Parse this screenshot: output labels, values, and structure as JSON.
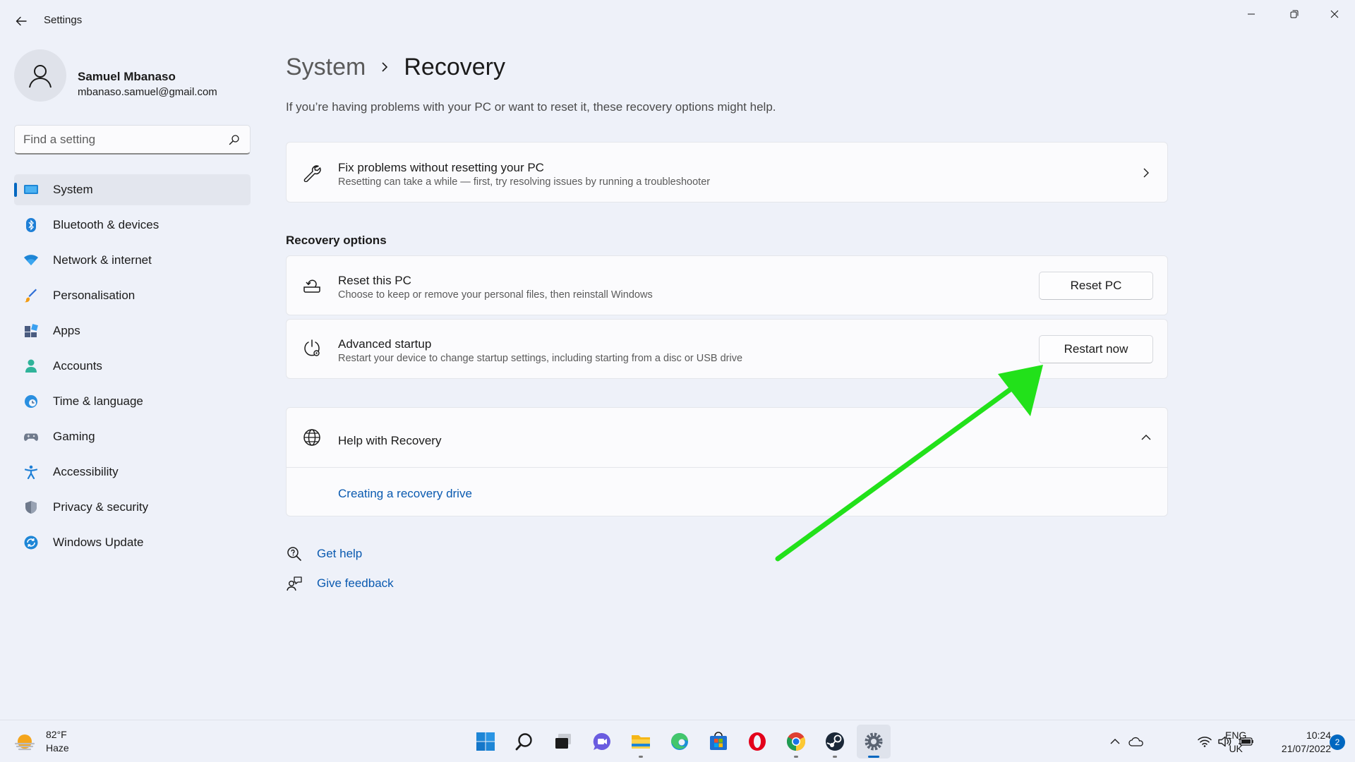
{
  "window": {
    "title": "Settings",
    "controls": [
      "minimize-icon",
      "restore-icon",
      "close-icon"
    ]
  },
  "profile": {
    "name": "Samuel Mbanaso",
    "email": "mbanaso.samuel@gmail.com"
  },
  "search": {
    "placeholder": "Find a setting"
  },
  "sidebar": {
    "items": [
      {
        "label": "System",
        "icon": "system-icon",
        "active": true
      },
      {
        "label": "Bluetooth & devices",
        "icon": "bluetooth-icon"
      },
      {
        "label": "Network & internet",
        "icon": "wifi-icon"
      },
      {
        "label": "Personalisation",
        "icon": "brush-icon"
      },
      {
        "label": "Apps",
        "icon": "apps-icon"
      },
      {
        "label": "Accounts",
        "icon": "accounts-icon"
      },
      {
        "label": "Time & language",
        "icon": "globe-clock-icon"
      },
      {
        "label": "Gaming",
        "icon": "gamepad-icon"
      },
      {
        "label": "Accessibility",
        "icon": "accessibility-icon"
      },
      {
        "label": "Privacy & security",
        "icon": "shield-icon"
      },
      {
        "label": "Windows Update",
        "icon": "update-icon"
      }
    ]
  },
  "breadcrumb": {
    "parent": "System",
    "current": "Recovery"
  },
  "subtitle": "If you’re having problems with your PC or want to reset it, these recovery options might help.",
  "fix_card": {
    "title": "Fix problems without resetting your PC",
    "description": "Resetting can take a while — first, try resolving issues by running a troubleshooter",
    "icon": "wrench-icon"
  },
  "recovery_options": {
    "section_title": "Recovery options",
    "reset": {
      "title": "Reset this PC",
      "description": "Choose to keep or remove your personal files, then reinstall Windows",
      "button": "Reset PC",
      "icon": "reset-pc-icon"
    },
    "advanced": {
      "title": "Advanced startup",
      "description": "Restart your device to change startup settings, including starting from a disc or USB drive",
      "button": "Restart now",
      "icon": "advanced-startup-icon"
    }
  },
  "help": {
    "title": "Help with Recovery",
    "link": "Creating a recovery drive",
    "icon": "globe-icon",
    "expanded": true
  },
  "footer_links": {
    "get_help": "Get help",
    "give_feedback": "Give feedback"
  },
  "annotation": {
    "arrow_color": "#22e11a",
    "points_to": "Restart now"
  },
  "taskbar": {
    "weather": {
      "temp": "82°F",
      "condition": "Haze",
      "icon": "haze-weather-icon"
    },
    "apps": [
      {
        "name": "start-icon"
      },
      {
        "name": "search-icon"
      },
      {
        "name": "task-view-icon"
      },
      {
        "name": "chat-icon"
      },
      {
        "name": "file-explorer-icon",
        "running": true
      },
      {
        "name": "edge-icon"
      },
      {
        "name": "store-icon"
      },
      {
        "name": "opera-icon"
      },
      {
        "name": "chrome-icon",
        "running": true
      },
      {
        "name": "steam-icon",
        "running": true
      },
      {
        "name": "settings-icon",
        "active": true
      }
    ],
    "language": {
      "line1": "ENG",
      "line2": "UK"
    },
    "time": "10:24",
    "date": "21/07/2022",
    "notifications": "2"
  },
  "colors": {
    "accent": "#0067c0",
    "link": "#0a5ab0",
    "background": "#eef1f9",
    "card": "#fbfbfd"
  }
}
